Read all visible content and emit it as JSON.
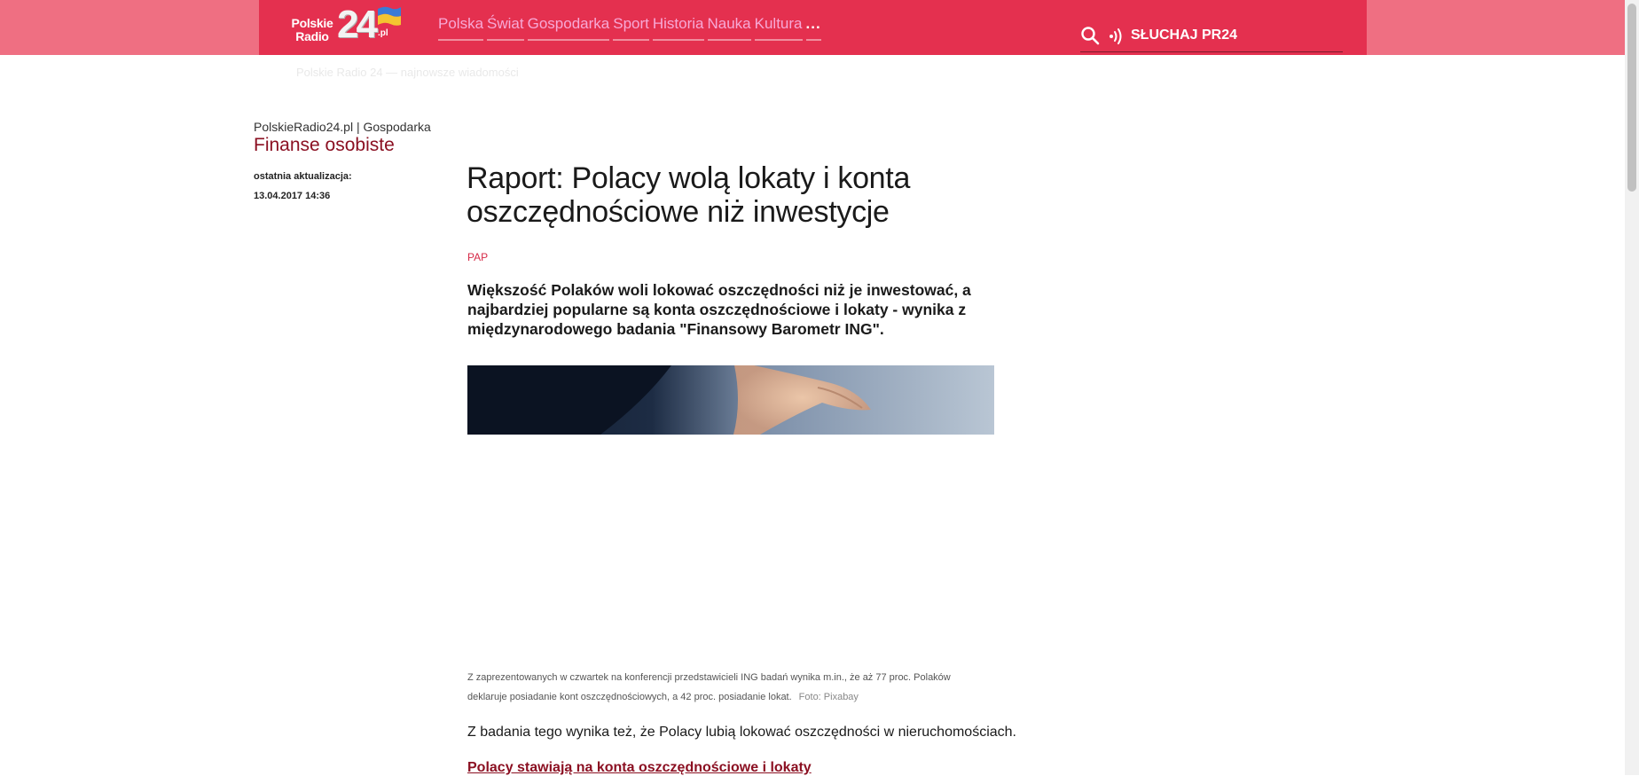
{
  "header": {
    "logo": {
      "line1": "Polskie",
      "line2": "Radio",
      "number": "24",
      "suffix": ".pl"
    },
    "nav": [
      {
        "label": "Polska"
      },
      {
        "label": "Świat"
      },
      {
        "label": "Gospodarka"
      },
      {
        "label": "Sport"
      },
      {
        "label": "Historia"
      },
      {
        "label": "Nauka"
      },
      {
        "label": "Kultura"
      },
      {
        "label": "..."
      }
    ],
    "search_icon": "search-icon",
    "listen_icon": "radio-waves-icon",
    "listen_label": "SŁUCHAJ PR24"
  },
  "ticker": {
    "text": "Polskie Radio 24 — najnowsze wiadomości"
  },
  "sidebar": {
    "breadcrumb_site": "PolskieRadio24.pl",
    "breadcrumb_separator": "|",
    "breadcrumb_section": "Gospodarka",
    "section_title": "Finanse osobiste",
    "updated_label": "ostatnia aktualizacja:",
    "updated_date": "13.04.2017 14:36"
  },
  "article": {
    "title_line1": "Raport: Polacy wolą lokaty i konta",
    "title_line2": "oszczędnościowe niż inwestycje",
    "source": "PAP",
    "lead_line1": "Większość Polaków woli lokować oszczędności niż je inwestować, a",
    "lead_line2": "najbardziej popularne są konta oszczędnościowe i lokaty - wynika z",
    "lead_line3": "międzynarodowego badania \"Finansowy Barometr ING\".",
    "caption_line1": "Z zaprezentowanych w czwartek na konferencji przedstawicieli ING badań wynika m.in., że aż 77 proc. Polaków",
    "caption_line2": "deklaruje posiadanie kont oszczędnościowych, a 42 proc. posiadanie lokat.",
    "photo_credit": "Foto: Pixabay",
    "paragraph1": "Z badania tego wynika też, że Polacy lubią lokować oszczędności w nieruchomościach.",
    "subheading": "Polacy stawiają na konta oszczędnościowe i lokaty"
  },
  "colors": {
    "brand_red": "#e4304f",
    "brand_band": "#ef6f82",
    "dark_red": "#8b1022",
    "nav_text": "#f7a9d6"
  }
}
